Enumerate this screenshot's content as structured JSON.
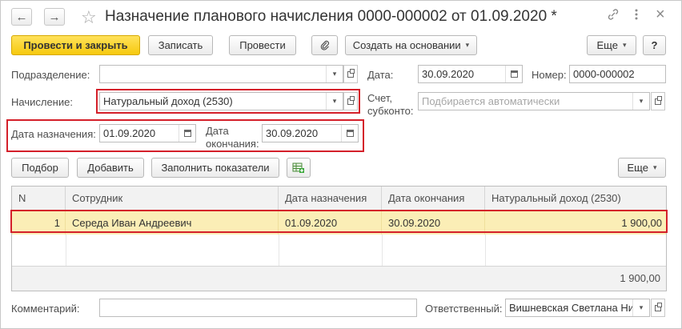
{
  "window": {
    "title": "Назначение планового начисления 0000-000002 от 01.09.2020 *",
    "back_icon": "←",
    "forward_icon": "→",
    "star_icon": "☆",
    "link_icon": "🔗",
    "more_icon": "⋮",
    "close_icon": "×"
  },
  "toolbar": {
    "post_and_close": "Провести и закрыть",
    "save": "Записать",
    "post": "Провести",
    "attach_icon": "📎",
    "create_based_on": "Создать на основании",
    "more": "Еще",
    "help": "?"
  },
  "form": {
    "department_label": "Подразделение:",
    "department_value": "",
    "date_label": "Дата:",
    "date_value": "30.09.2020",
    "number_label": "Номер:",
    "number_value": "0000-000002",
    "accrual_label": "Начисление:",
    "accrual_value": "Натуральный доход (2530)",
    "account_label_1": "Счет,",
    "account_label_2": "субконто:",
    "account_placeholder": "Подбирается автоматически",
    "assign_date_label": "Дата назначения:",
    "assign_date_value": "01.09.2020",
    "end_date_label_1": "Дата",
    "end_date_label_2": "окончания:",
    "end_date_value": "30.09.2020"
  },
  "table_toolbar": {
    "select": "Подбор",
    "add": "Добавить",
    "fill": "Заполнить показатели",
    "more": "Еще"
  },
  "table": {
    "columns": [
      "N",
      "Сотрудник",
      "Дата назначения",
      "Дата окончания",
      "Натуральный доход (2530)"
    ],
    "rows": [
      {
        "n": "1",
        "employee": "Середа Иван Андреевич",
        "start": "01.09.2020",
        "end": "30.09.2020",
        "amount": "1 900,00"
      }
    ],
    "total": "1 900,00"
  },
  "bottom": {
    "comment_label": "Комментарий:",
    "comment_value": "",
    "responsible_label": "Ответственный:",
    "responsible_value": "Вишневская Светлана Ни"
  }
}
